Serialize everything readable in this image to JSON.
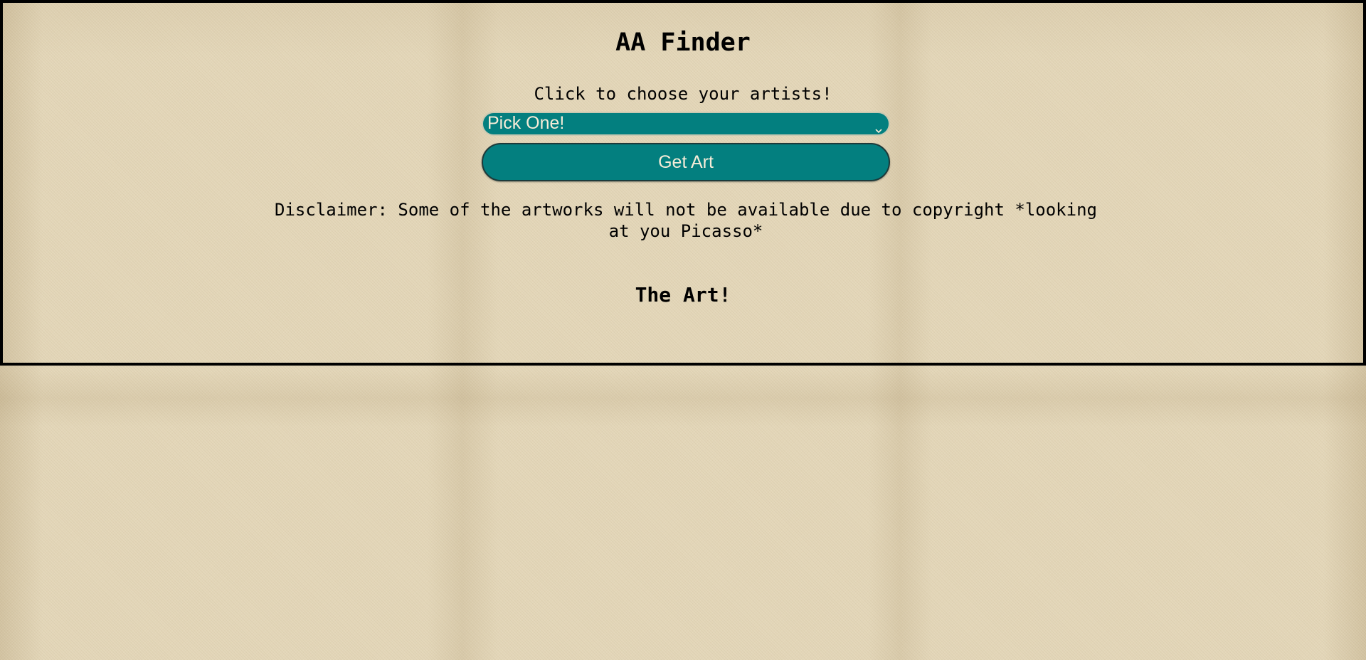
{
  "page": {
    "title": "AA Finder",
    "instruction": "Click to choose your artists!",
    "artist_select": {
      "selected": "Pick One!",
      "icon": "chevron-down-icon"
    },
    "get_art_label": "Get Art",
    "disclaimer": "Disclaimer: Some of the artworks will not be available due to copyright *looking at you Picasso*",
    "art_heading": "The Art!"
  },
  "colors": {
    "button_bg": "#037f7f",
    "button_text": "#f6ecd8",
    "border": "#000000",
    "background": "#e3d6b8"
  }
}
